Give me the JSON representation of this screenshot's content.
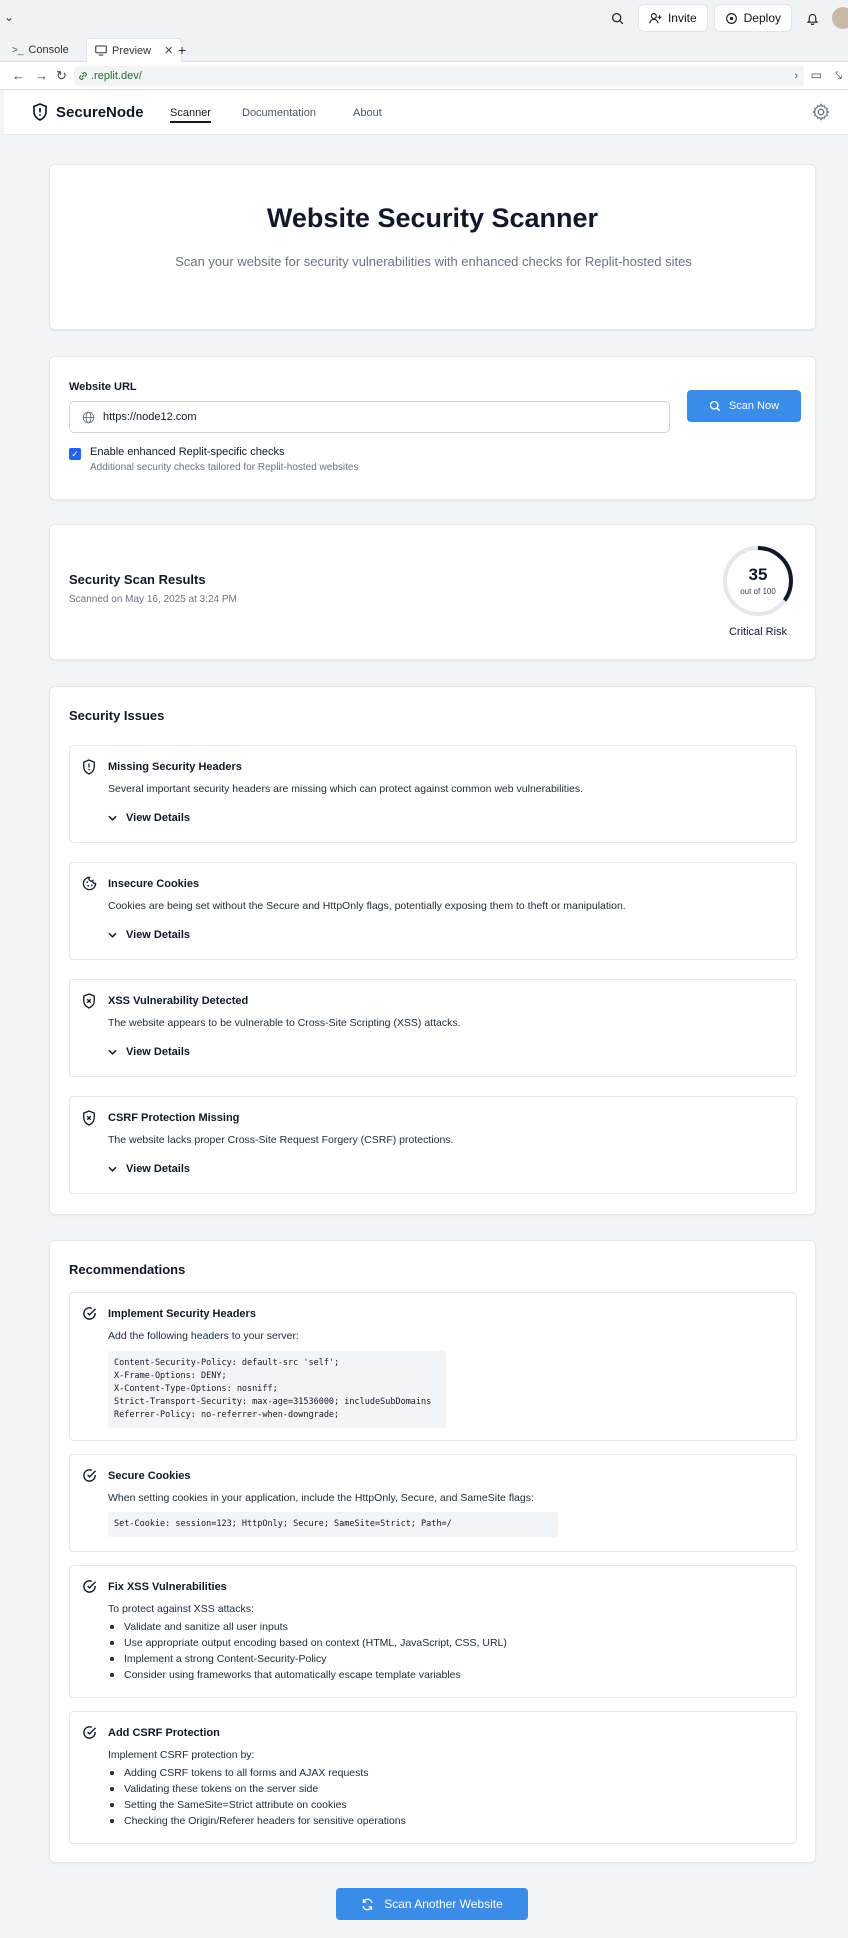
{
  "chrome": {
    "invite_label": "Invite",
    "deploy_label": "Deploy",
    "tabs": [
      {
        "label": "Console"
      },
      {
        "label": "Preview"
      }
    ],
    "url": ".replit.dev/"
  },
  "nav": {
    "brand": "SecureNode",
    "links": [
      "Scanner",
      "Documentation",
      "About"
    ]
  },
  "hero": {
    "title": "Website Security Scanner",
    "subtitle": "Scan your website for security vulnerabilities with enhanced checks for Replit-hosted sites"
  },
  "scan_form": {
    "url_label": "Website URL",
    "url_value": "https://node12.com",
    "scan_button": "Scan Now",
    "enhanced_checked": true,
    "enhanced_label": "Enable enhanced Replit-specific checks",
    "enhanced_hint": "Additional security checks tailored for Replit-hosted websites"
  },
  "results": {
    "title": "Security Scan Results",
    "scanned_on": "Scanned on May 16, 2025 at 3:24 PM",
    "score": "35",
    "score_fraction": 0.35,
    "score_of": "out of 100",
    "risk": "Critical Risk"
  },
  "issues": {
    "title": "Security Issues",
    "view_details": "View Details",
    "items": [
      {
        "title": "Missing Security Headers",
        "desc": "Several important security headers are missing which can protect against common web vulnerabilities.",
        "icon": "shield-alert-icon"
      },
      {
        "title": "Insecure Cookies",
        "desc": "Cookies are being set without the Secure and HttpOnly flags, potentially exposing them to theft or manipulation.",
        "icon": "cookie-icon"
      },
      {
        "title": "XSS Vulnerability Detected",
        "desc": "The website appears to be vulnerable to Cross-Site Scripting (XSS) attacks.",
        "icon": "shield-x-icon"
      },
      {
        "title": "CSRF Protection Missing",
        "desc": "The website lacks proper Cross-Site Request Forgery (CSRF) protections.",
        "icon": "shield-x-icon"
      }
    ]
  },
  "recommendations": {
    "title": "Recommendations",
    "items": [
      {
        "title": "Implement Security Headers",
        "desc": "Add the following headers to your server:",
        "code": "Content-Security-Policy: default-src 'self';\nX-Frame-Options: DENY;\nX-Content-Type-Options: nosniff;\nStrict-Transport-Security: max-age=31536000; includeSubDomains\nReferrer-Policy: no-referrer-when-downgrade;"
      },
      {
        "title": "Secure Cookies",
        "desc": "When setting cookies in your application, include the HttpOnly, Secure, and SameSite flags:",
        "code": "Set-Cookie: session=123; HttpOnly; Secure; SameSite=Strict; Path=/"
      },
      {
        "title": "Fix XSS Vulnerabilities",
        "desc": "To protect against XSS attacks:",
        "bullets": [
          "Validate and sanitize all user inputs",
          "Use appropriate output encoding based on context (HTML, JavaScript, CSS, URL)",
          "Implement a strong Content-Security-Policy",
          "Consider using frameworks that automatically escape template variables"
        ]
      },
      {
        "title": "Add CSRF Protection",
        "desc": "Implement CSRF protection by:",
        "bullets": [
          "Adding CSRF tokens to all forms and AJAX requests",
          "Validating these tokens on the server side",
          "Setting the SameSite=Strict attribute on cookies",
          "Checking the Origin/Referer headers for sensitive operations"
        ]
      }
    ]
  },
  "footer_button": "Scan Another Website",
  "colors": {
    "accent": "#3b8be8",
    "score_ring": "#111827",
    "ring_track": "#e5e7eb"
  }
}
